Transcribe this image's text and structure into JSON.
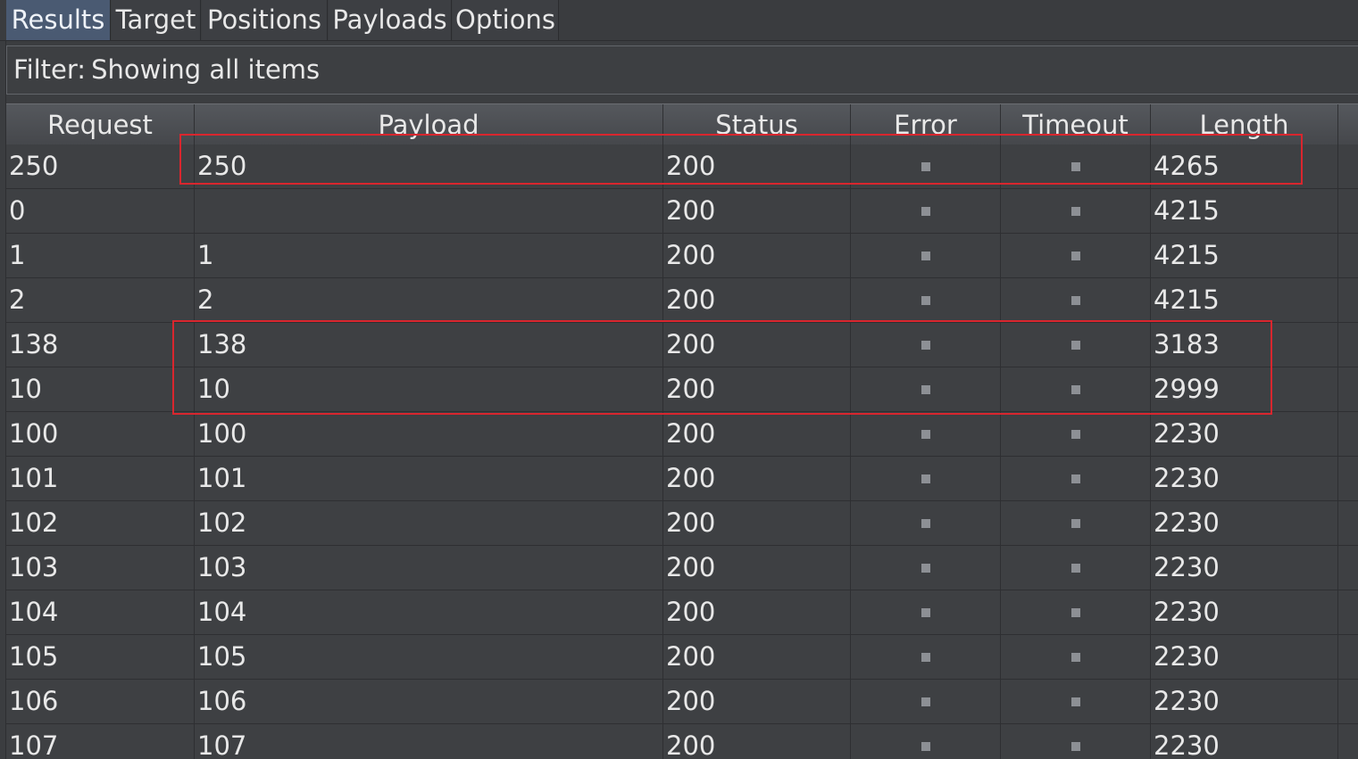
{
  "tabs": [
    {
      "label": "Results",
      "active": true
    },
    {
      "label": "Target",
      "active": false
    },
    {
      "label": "Positions",
      "active": false
    },
    {
      "label": "Payloads",
      "active": false
    },
    {
      "label": "Options",
      "active": false
    }
  ],
  "filter": {
    "prefix": "Filter:",
    "text": "Showing all items"
  },
  "table": {
    "columns": [
      "Request",
      "Payload",
      "Status",
      "Error",
      "Timeout",
      "Length"
    ],
    "rows": [
      {
        "request": "250",
        "payload": "250",
        "status": "200",
        "error": false,
        "timeout": false,
        "length": "4265"
      },
      {
        "request": "0",
        "payload": "",
        "status": "200",
        "error": false,
        "timeout": false,
        "length": "4215"
      },
      {
        "request": "1",
        "payload": "1",
        "status": "200",
        "error": false,
        "timeout": false,
        "length": "4215"
      },
      {
        "request": "2",
        "payload": "2",
        "status": "200",
        "error": false,
        "timeout": false,
        "length": "4215"
      },
      {
        "request": "138",
        "payload": "138",
        "status": "200",
        "error": false,
        "timeout": false,
        "length": "3183"
      },
      {
        "request": "10",
        "payload": "10",
        "status": "200",
        "error": false,
        "timeout": false,
        "length": "2999"
      },
      {
        "request": "100",
        "payload": "100",
        "status": "200",
        "error": false,
        "timeout": false,
        "length": "2230"
      },
      {
        "request": "101",
        "payload": "101",
        "status": "200",
        "error": false,
        "timeout": false,
        "length": "2230"
      },
      {
        "request": "102",
        "payload": "102",
        "status": "200",
        "error": false,
        "timeout": false,
        "length": "2230"
      },
      {
        "request": "103",
        "payload": "103",
        "status": "200",
        "error": false,
        "timeout": false,
        "length": "2230"
      },
      {
        "request": "104",
        "payload": "104",
        "status": "200",
        "error": false,
        "timeout": false,
        "length": "2230"
      },
      {
        "request": "105",
        "payload": "105",
        "status": "200",
        "error": false,
        "timeout": false,
        "length": "2230"
      },
      {
        "request": "106",
        "payload": "106",
        "status": "200",
        "error": false,
        "timeout": false,
        "length": "2230"
      },
      {
        "request": "107",
        "payload": "107",
        "status": "200",
        "error": false,
        "timeout": false,
        "length": "2230"
      }
    ]
  },
  "colors": {
    "highlight": "#d9262e",
    "active_tab": "#4a5a72",
    "background": "#3e4043"
  }
}
